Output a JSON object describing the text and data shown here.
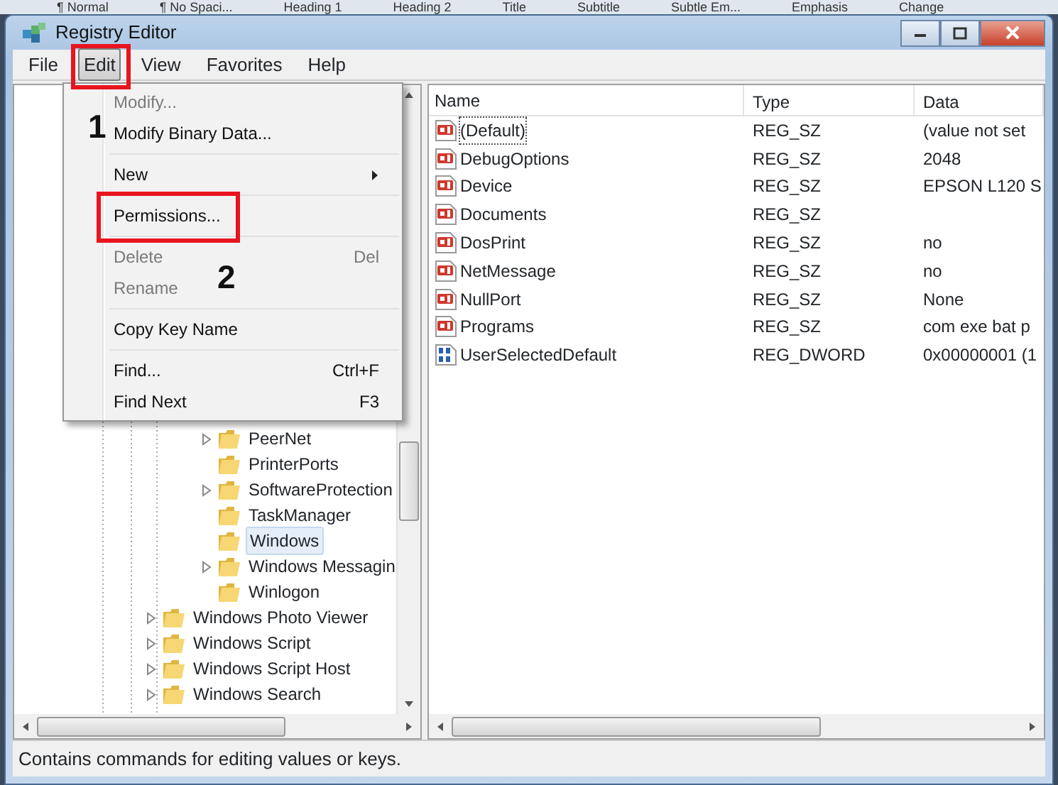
{
  "background_ribbon": [
    "¶ Normal",
    "¶ No Spaci...",
    "Heading 1",
    "Heading 2",
    "Title",
    "Subtitle",
    "Subtle Em...",
    "Emphasis",
    "Change"
  ],
  "window": {
    "title": "Registry Editor"
  },
  "menu_bar": [
    {
      "label": "File",
      "selected": false
    },
    {
      "label": "Edit",
      "selected": true
    },
    {
      "label": "View",
      "selected": false
    },
    {
      "label": "Favorites",
      "selected": false
    },
    {
      "label": "Help",
      "selected": false
    }
  ],
  "edit_menu": [
    {
      "kind": "item",
      "label": "Modify...",
      "disabled": true
    },
    {
      "kind": "item",
      "label": "Modify Binary Data...",
      "disabled": false
    },
    {
      "kind": "separator"
    },
    {
      "kind": "submenu",
      "label": "New",
      "disabled": false
    },
    {
      "kind": "separator"
    },
    {
      "kind": "item",
      "label": "Permissions...",
      "disabled": false,
      "highlighted": true
    },
    {
      "kind": "separator"
    },
    {
      "kind": "item",
      "label": "Delete",
      "shortcut": "Del",
      "disabled": true
    },
    {
      "kind": "item",
      "label": "Rename",
      "disabled": true
    },
    {
      "kind": "separator"
    },
    {
      "kind": "item",
      "label": "Copy Key Name",
      "disabled": false
    },
    {
      "kind": "separator"
    },
    {
      "kind": "item",
      "label": "Find...",
      "shortcut": "Ctrl+F",
      "disabled": false
    },
    {
      "kind": "item",
      "label": "Find Next",
      "shortcut": "F3",
      "disabled": false
    }
  ],
  "annotations": [
    {
      "label": "1"
    },
    {
      "label": "2"
    }
  ],
  "tree": {
    "items": [
      {
        "children": [
          {
            "label": "PeerNet",
            "expandable": true,
            "selected": false
          },
          {
            "label": "PrinterPorts",
            "expandable": false,
            "selected": false
          },
          {
            "label": "SoftwareProtection",
            "expandable": true,
            "selected": false
          },
          {
            "label": "TaskManager",
            "expandable": false,
            "selected": false
          },
          {
            "label": "Windows",
            "expandable": false,
            "selected": true
          },
          {
            "label": "Windows Messagin",
            "expandable": true,
            "selected": false
          },
          {
            "label": "Winlogon",
            "expandable": false,
            "selected": false
          }
        ]
      },
      {
        "label": "Windows Photo Viewer",
        "expandable": true,
        "selected": false
      },
      {
        "label": "Windows Script",
        "expandable": true,
        "selected": false
      },
      {
        "label": "Windows Script Host",
        "expandable": true,
        "selected": false
      },
      {
        "label": "Windows Search",
        "expandable": true,
        "selected": false
      }
    ]
  },
  "values_table": {
    "columns": [
      "Name",
      "Type",
      "Data"
    ],
    "rows": [
      {
        "kind": "string",
        "name": "(Default)",
        "type": "REG_SZ",
        "data": "(value not set",
        "selected": true
      },
      {
        "kind": "string",
        "name": "DebugOptions",
        "type": "REG_SZ",
        "data": "2048",
        "selected": false
      },
      {
        "kind": "string",
        "name": "Device",
        "type": "REG_SZ",
        "data": "EPSON L120 S",
        "selected": false
      },
      {
        "kind": "string",
        "name": "Documents",
        "type": "REG_SZ",
        "selected": false
      },
      {
        "kind": "string",
        "name": "DosPrint",
        "type": "REG_SZ",
        "data": "no",
        "selected": false
      },
      {
        "kind": "string",
        "name": "NetMessage",
        "type": "REG_SZ",
        "data": "no",
        "selected": false
      },
      {
        "kind": "string",
        "name": "NullPort",
        "type": "REG_SZ",
        "data": "None",
        "selected": false
      },
      {
        "kind": "string",
        "name": "Programs",
        "type": "REG_SZ",
        "data": "com exe bat p",
        "selected": false
      },
      {
        "kind": "dword",
        "name": "UserSelectedDefault",
        "type": "REG_DWORD",
        "data": "0x00000001 (1",
        "selected": false
      }
    ]
  },
  "status_bar": "Contains commands for editing values or keys."
}
